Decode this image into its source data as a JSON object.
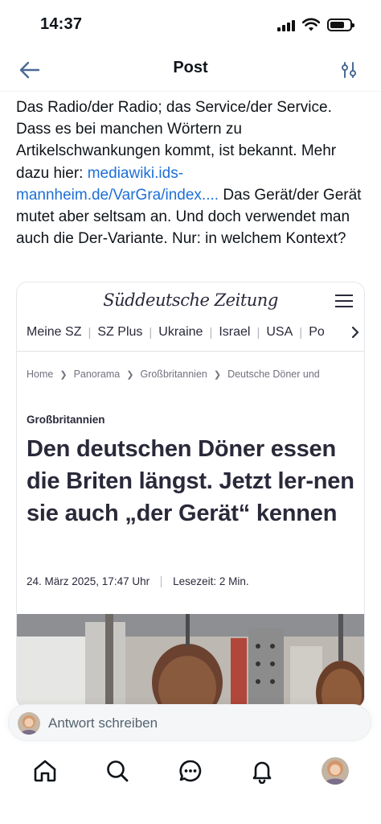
{
  "status_bar": {
    "time": "14:37",
    "icons": [
      "cellular-signal-icon",
      "wifi-icon",
      "battery-icon"
    ]
  },
  "header": {
    "title": "Post",
    "back_icon": "arrow-left-icon",
    "filter_icon": "sliders-icon"
  },
  "post": {
    "text_before_link": "Das Radio/der Radio; das Service/der Service. Dass es bei manchen Wörtern zu Artikelschwankungen kommt, ist bekannt. Mehr dazu hier: ",
    "link_text": "mediawiki.ids-mannheim.de/VarGra/index....",
    "text_after_link": " Das Gerät/der Gerät mutet aber seltsam an. Und doch verwendet man auch die Der-Variante. Nur: in welchem Kontext?"
  },
  "embedded_image": {
    "logo": "Süddeutsche Zeitung",
    "nav_items": [
      "Meine SZ",
      "SZ Plus",
      "Ukraine",
      "Israel",
      "USA",
      "Po"
    ],
    "breadcrumb": [
      "Home",
      "Panorama",
      "Großbritannien",
      "Deutsche Döner und"
    ],
    "kicker": "Großbritannien",
    "headline": "Den deutschen Döner essen die Briten längst. Jetzt ler-nen sie auch „der Gerät“ kennen",
    "date": "24. März 2025, 17:47 Uhr",
    "reading_time": "Lesezeit: 2 Min."
  },
  "reply_bar": {
    "placeholder": "Antwort schreiben"
  },
  "tab_bar": {
    "items": [
      "home-icon",
      "search-icon",
      "messages-icon",
      "notifications-icon",
      "profile-avatar"
    ]
  },
  "colors": {
    "link": "#1d6fd6",
    "header_icon": "#4a6a94",
    "text": "#0f1419",
    "sz_text": "#29293a"
  }
}
